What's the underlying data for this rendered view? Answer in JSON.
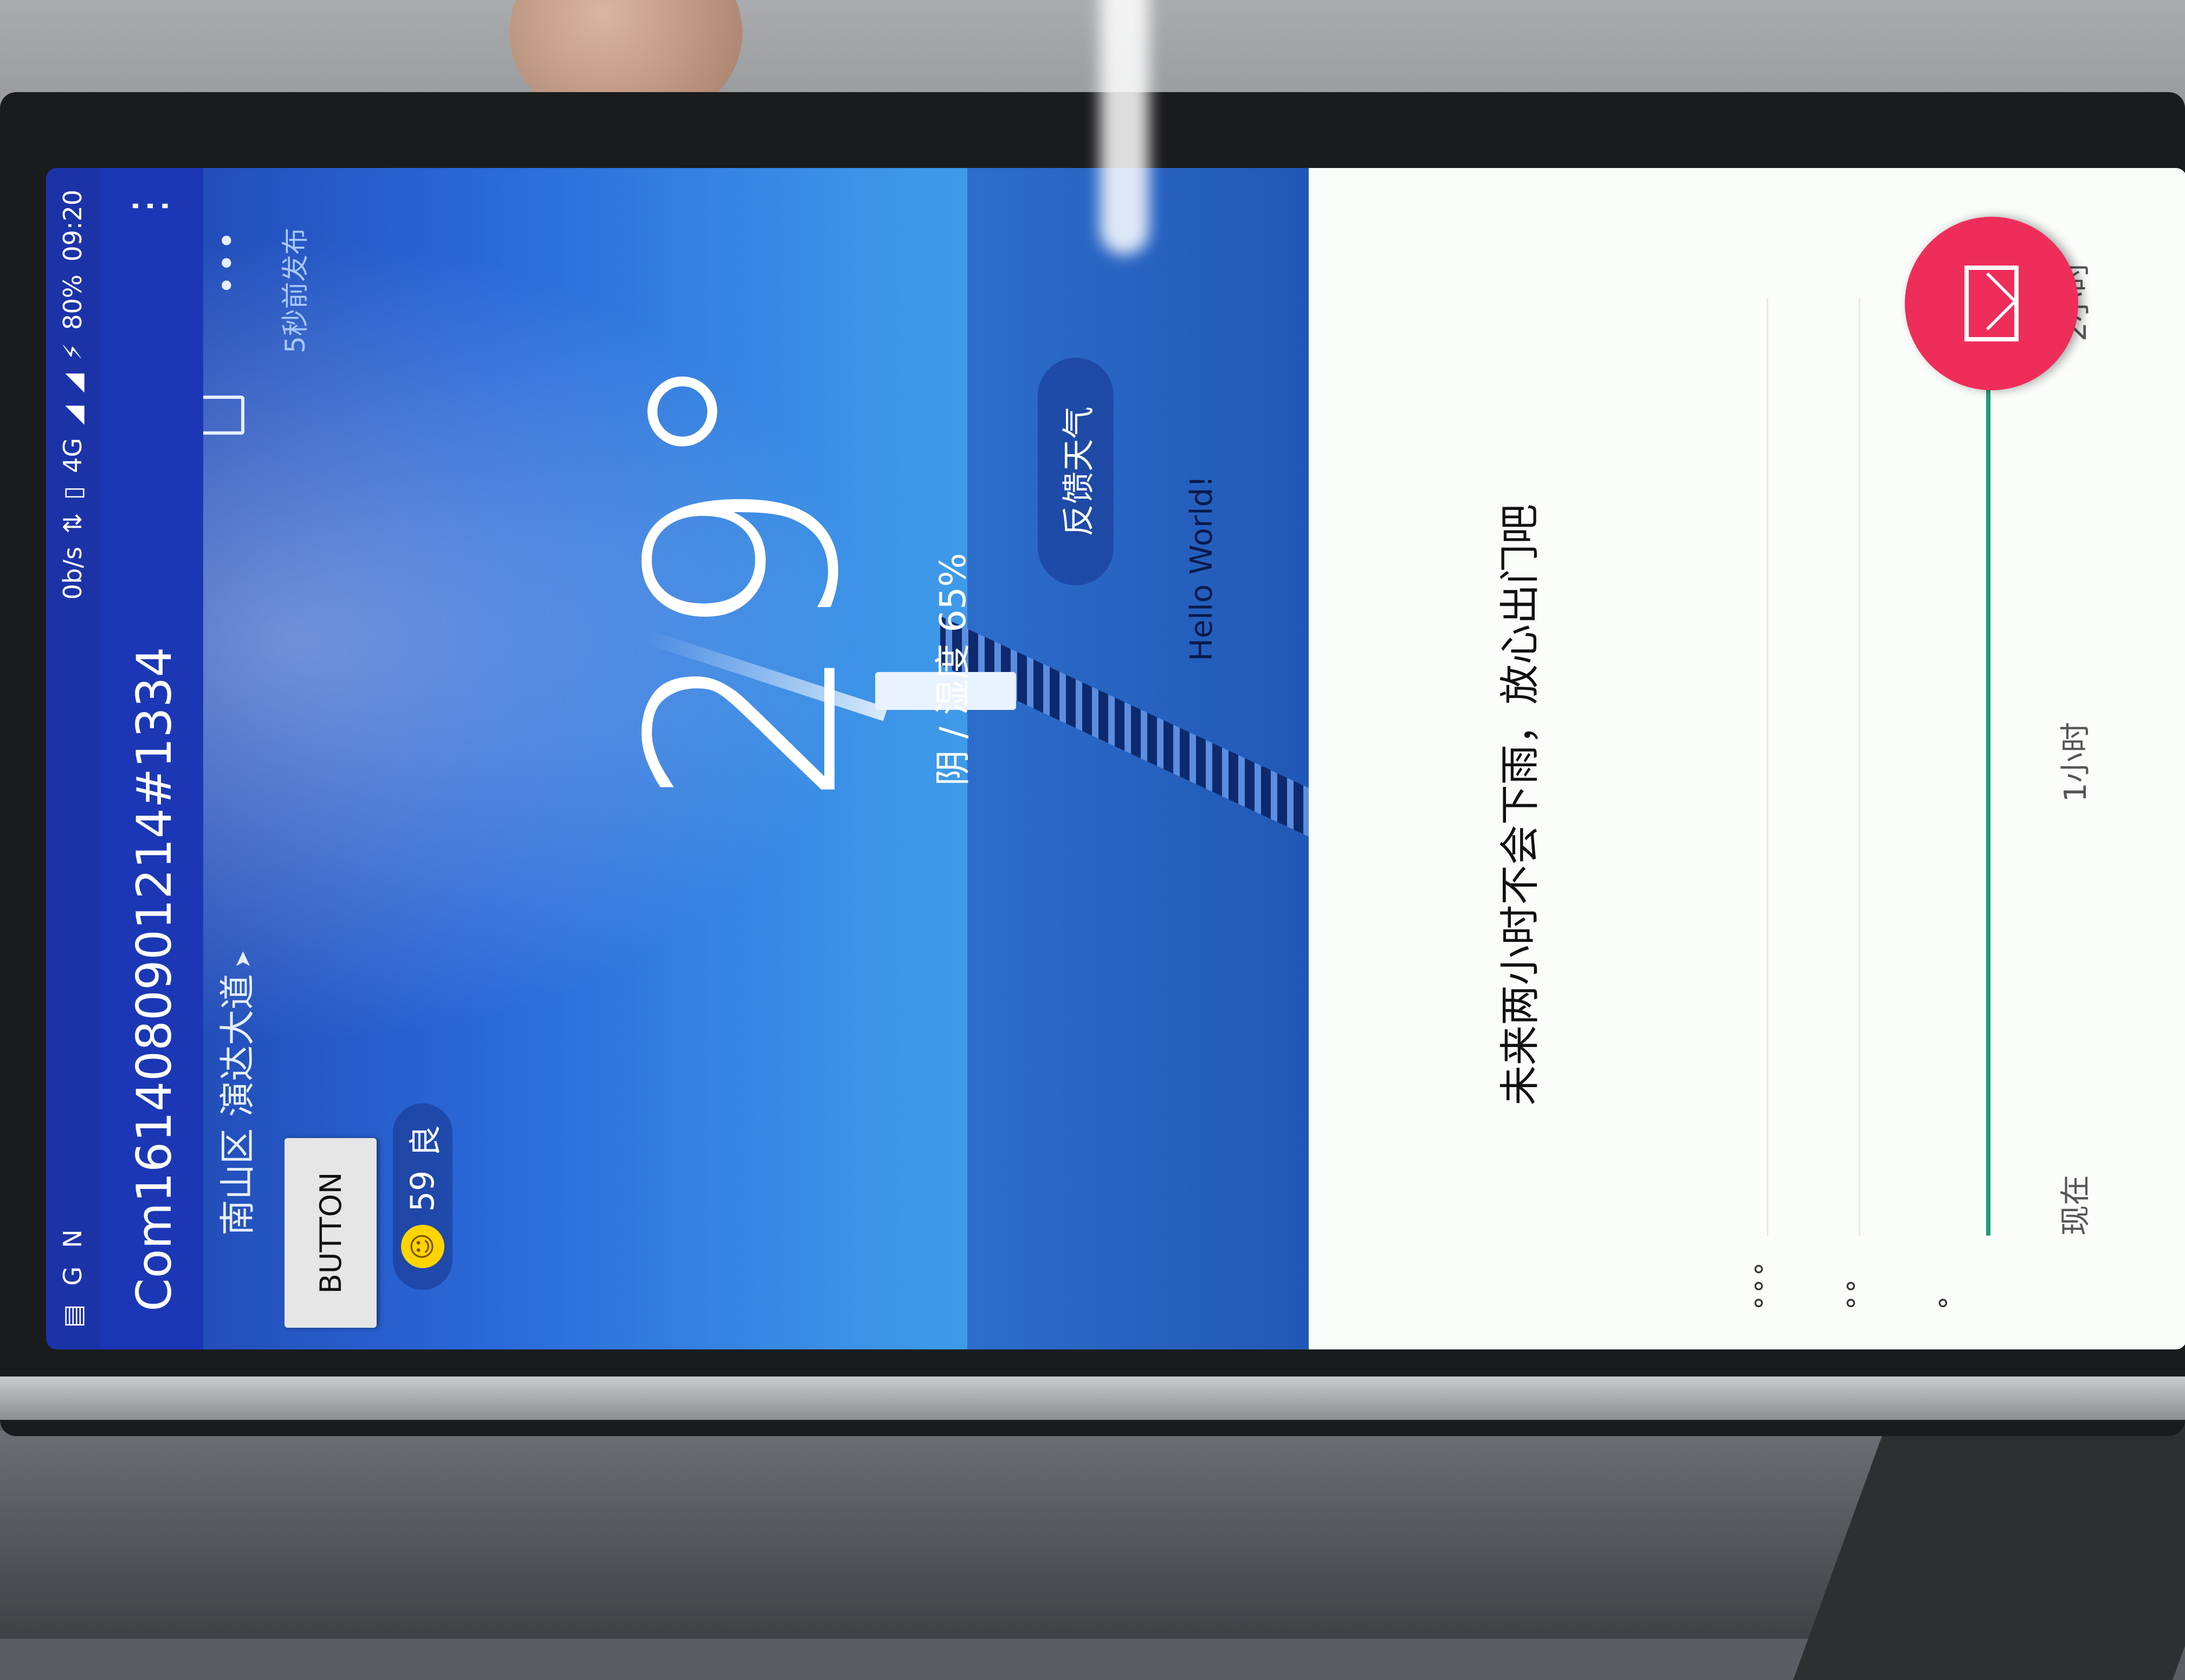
{
  "status_bar": {
    "net_speed": "0b/s",
    "network": "4G",
    "battery": "80%",
    "time": "09:20"
  },
  "app_bar": {
    "title": "Com161408090121​4#1334",
    "overflow_icon": "more-vert-icon"
  },
  "location": {
    "name": "南山区 演达大道",
    "publish_time": "5秒前发布"
  },
  "button": {
    "label": "BUTTON"
  },
  "aqi": {
    "value": "59",
    "level": "良"
  },
  "weather": {
    "temperature": "29°",
    "condition": "阴",
    "separator": "/",
    "humidity": "湿度 65%",
    "feedback_label": "反馈天气",
    "hello": "Hello World!"
  },
  "forecast": {
    "text": "未来两小时不会下雨，放心出门吧",
    "x_labels": [
      "现在",
      "1小时",
      "2小时"
    ]
  },
  "colors": {
    "accent": "#1c37b5",
    "fab": "#ef2d5a",
    "rain_line": "#1a9e79"
  }
}
